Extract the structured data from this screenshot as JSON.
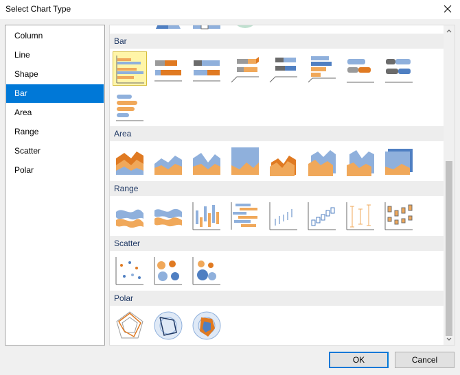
{
  "window": {
    "title": "Select Chart Type",
    "close_icon": "close-icon"
  },
  "categories": [
    {
      "label": "Column"
    },
    {
      "label": "Line"
    },
    {
      "label": "Shape"
    },
    {
      "label": "Bar",
      "selected": true
    },
    {
      "label": "Area"
    },
    {
      "label": "Range"
    },
    {
      "label": "Scatter"
    },
    {
      "label": "Polar"
    }
  ],
  "gallery": {
    "groups": [
      {
        "header": "Bar",
        "thumbnails": [
          "bar-clustered-icon",
          "bar-stacked-icon",
          "bar-stacked-100-icon",
          "bar-3d-clustered-icon",
          "bar-3d-stacked-icon",
          "bar-3d-stacked-100-icon",
          "bar-cylinder-clustered-icon",
          "bar-cylinder-stacked-icon",
          "bar-cylinder-stacked-100-icon"
        ],
        "selected_index": 0
      },
      {
        "header": "Area",
        "thumbnails": [
          "area-icon",
          "area-stacked-icon",
          "area-stacked-100-icon",
          "area-full-icon",
          "area-3d-icon",
          "area-3d-stacked-icon",
          "area-3d-stacked-100-icon",
          "area-3d-full-icon"
        ]
      },
      {
        "header": "Range",
        "thumbnails": [
          "range-area-icon",
          "range-spline-area-icon",
          "range-column-icon",
          "range-bar-icon",
          "stock-hlc-icon",
          "stock-candlestick-icon",
          "error-bar-icon",
          "box-plot-icon"
        ]
      },
      {
        "header": "Scatter",
        "thumbnails": [
          "scatter-point-icon",
          "bubble-icon",
          "bubble-3d-icon"
        ]
      },
      {
        "header": "Polar",
        "thumbnails": [
          "radar-line-icon",
          "polar-line-icon",
          "polar-area-icon"
        ]
      }
    ]
  },
  "colors": {
    "orange": "#f0a85a",
    "dark_orange": "#e07a22",
    "blue": "#8fb0dc",
    "dark_blue": "#4f7fc2",
    "gray": "#9a9a9a",
    "dark_gray": "#6b6b6b",
    "selection": "#0078d7"
  },
  "buttons": {
    "ok": "OK",
    "cancel": "Cancel"
  }
}
